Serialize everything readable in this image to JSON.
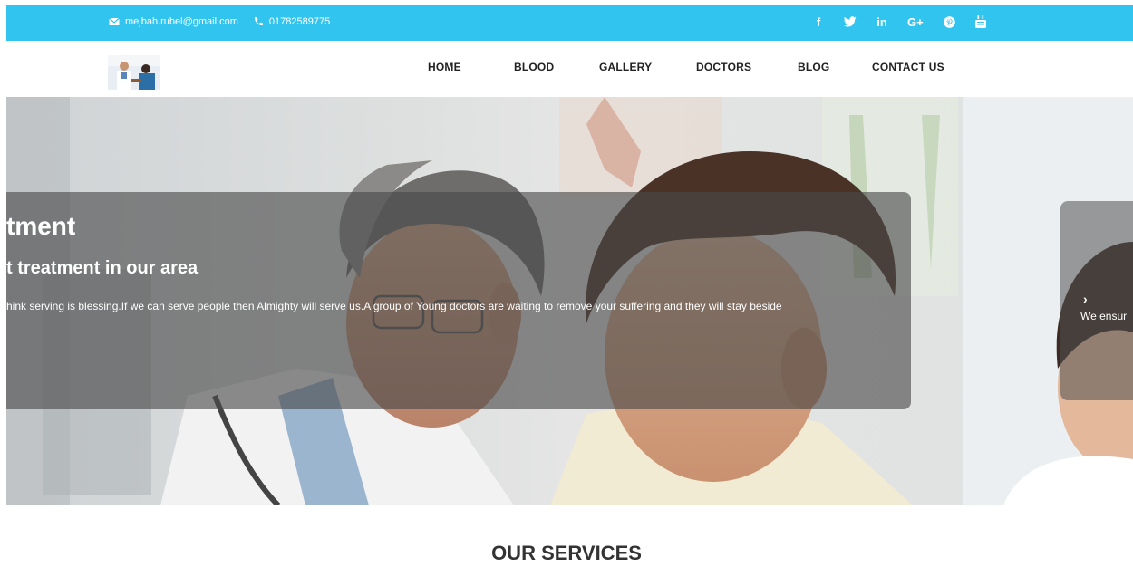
{
  "topbar": {
    "email": "mejbah.rubel@gmail.com",
    "phone": "01782589775",
    "social": [
      {
        "icon": "facebook-icon",
        "glyph": "f"
      },
      {
        "icon": "twitter-icon",
        "glyph": "🐦"
      },
      {
        "icon": "linkedin-icon",
        "glyph": "in"
      },
      {
        "icon": "google-plus-icon",
        "glyph": "G+"
      },
      {
        "icon": "pinterest-icon",
        "glyph": "℗"
      },
      {
        "icon": "youtube-icon",
        "glyph": "▣"
      }
    ],
    "bg_color": "#31c4ef"
  },
  "nav": {
    "items": [
      {
        "label": "HOME"
      },
      {
        "label": "BLOOD"
      },
      {
        "label": "GALLERY"
      },
      {
        "label": "DOCTORS"
      },
      {
        "label": "BLOG"
      },
      {
        "label": "CONTACT US"
      }
    ]
  },
  "hero": {
    "title": "tment",
    "subtitle": "t treatment in our area",
    "text": "hink serving is blessing.If we can serve people then Almighty will serve us.A group of Young doctors are waiting to remove your suffering and they will stay beside",
    "next_arrow": "›",
    "next_text": "We ensur"
  },
  "services": {
    "heading": "OUR SERVICES"
  }
}
